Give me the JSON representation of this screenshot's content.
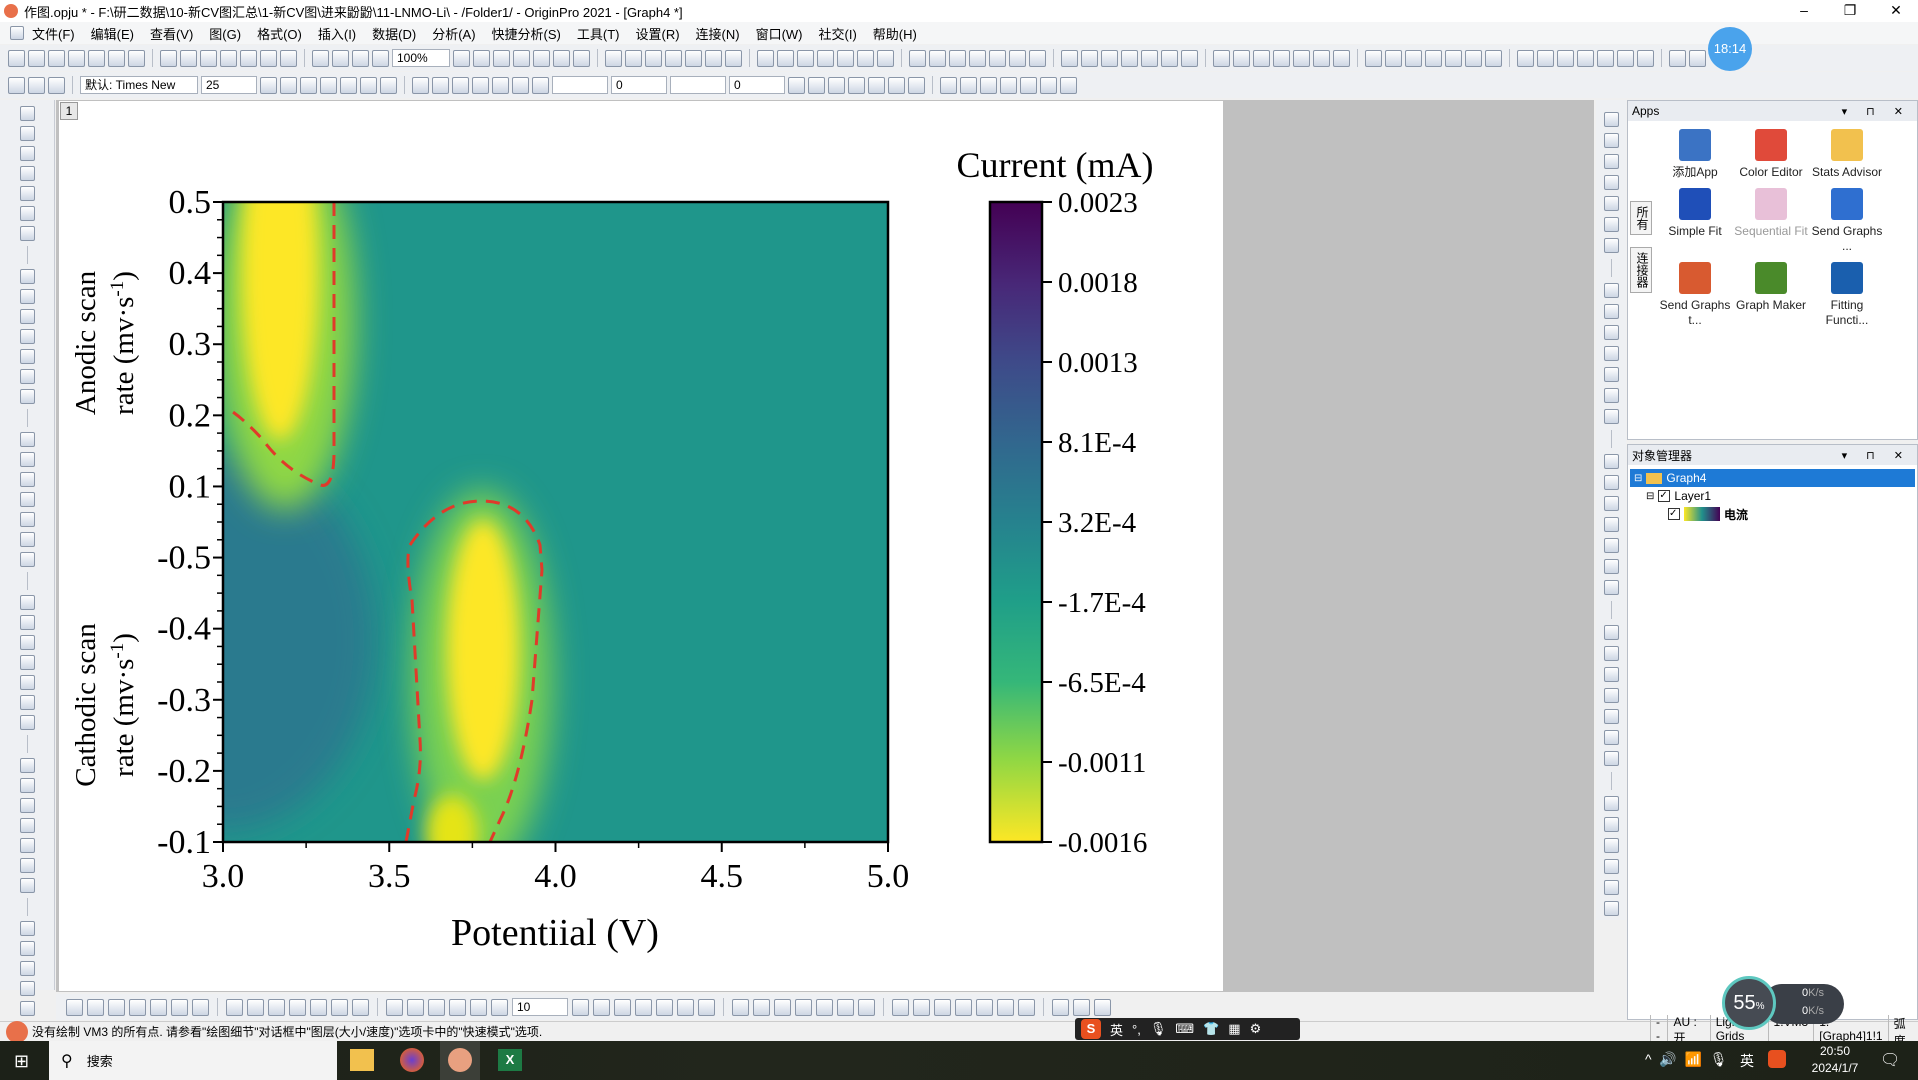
{
  "window": {
    "title": "作图.opju * - F:\\研二数据\\10-新CV图汇总\\1-新CV图\\进来鼢鼢\\11-LNMO-Li\\ - /Folder1/ - OriginPro 2021 - [Graph4 *]",
    "controls": [
      "minimize",
      "restore",
      "close"
    ]
  },
  "menu": [
    "文件(F)",
    "编辑(E)",
    "查看(V)",
    "图(G)",
    "格式(O)",
    "插入(I)",
    "数据(D)",
    "分析(A)",
    "快捷分析(S)",
    "工具(T)",
    "设置(R)",
    "连接(N)",
    "窗口(W)",
    "社交(I)",
    "帮助(H)"
  ],
  "toolbar": {
    "zoom": "100%",
    "font_name": "默认: Times New",
    "font_size": "25",
    "line_width": "0",
    "pattern_value": "0",
    "bottom_size": "10"
  },
  "clock_badge": "18:14",
  "graph": {
    "layer_tab": "1",
    "accent_colors": {
      "contour": "#e03a2a",
      "background": "#21918c"
    }
  },
  "chart_data": {
    "type": "heatmap",
    "colormap": "viridis (reversed: yellow = low, purple = high)",
    "xlabel": "Potentiial (V)",
    "xlim": [
      3.0,
      5.0
    ],
    "xticks": [
      "3.0",
      "3.5",
      "4.0",
      "4.5",
      "5.0"
    ],
    "ylabel_top": "Anodic scan rate (mv·s⁻¹)",
    "ylabel_top_lines": [
      "Anodic scan",
      "rate (mv·s",
      "-1",
      ")"
    ],
    "ylabel_bottom_lines": [
      "Cathodic scan",
      "rate (mv·s",
      "-1",
      ")"
    ],
    "yticks": [
      "0.5",
      "0.4",
      "0.3",
      "0.2",
      "0.1",
      "-0.5",
      "-0.4",
      "-0.3",
      "-0.2",
      "-0.1"
    ],
    "colorbar": {
      "title": "Current (mA)",
      "range": [
        -0.0016,
        0.0023
      ],
      "ticks": [
        "0.0023",
        "0.0018",
        "0.0013",
        "8.1E-4",
        "3.2E-4",
        "-1.7E-4",
        "-6.5E-4",
        "-0.0011",
        "-0.0016"
      ]
    },
    "features": [
      {
        "region": "anodic",
        "potential_range": [
          3.0,
          3.33
        ],
        "rate_range": [
          0.1,
          0.5
        ],
        "value": "low (≈ -0.0016)",
        "contour": "dashed red"
      },
      {
        "region": "cathodic",
        "potential_center": 3.8,
        "potential_range": [
          3.55,
          3.97
        ],
        "rate_range": [
          "-0.5",
          "-0.1"
        ],
        "value": "low (≈ -0.0016)",
        "contour": "dashed red"
      },
      {
        "region": "cathodic left edge",
        "potential_range": [
          3.0,
          3.3
        ],
        "value": "≈ 3.2E-4"
      }
    ],
    "background_value": "≈ -1.7E-4",
    "grid": false
  },
  "apps_panel": {
    "title": "Apps",
    "tabs": [
      "所有",
      "连接器"
    ],
    "items": [
      {
        "label": "添加App",
        "icon": "add-app-icon"
      },
      {
        "label": "Color Editor",
        "icon": "color-editor-icon"
      },
      {
        "label": "Stats Advisor",
        "icon": "magic-wand-icon"
      },
      {
        "label": "Simple Fit",
        "icon": "simple-fit-icon"
      },
      {
        "label": "Sequential Fit",
        "icon": "sequential-fit-icon"
      },
      {
        "label": "Send Graphs ...",
        "icon": "send-word-icon"
      },
      {
        "label": "Send Graphs t...",
        "icon": "send-ppt-icon"
      },
      {
        "label": "Graph Maker",
        "icon": "graph-maker-icon"
      },
      {
        "label": "Fitting Functi...",
        "icon": "fitting-function-icon"
      }
    ]
  },
  "object_manager": {
    "title": "对象管理器",
    "graph": "Graph4",
    "layer": "Layer1",
    "plot": "电流"
  },
  "status": {
    "message": "没有绘制 VM3 的所有点. 请参看\"绘图细节\"对话框中\"图层(大小/速度)\"选项卡中的\"快速模式\"选项.",
    "fields": [
      "--",
      "AU : 开",
      "Light Grids",
      "1:VM3",
      "1:[Graph4]1!1",
      "弧度"
    ]
  },
  "speed_widget": {
    "percent": "55",
    "unit": "%",
    "up": "0",
    "down": "0",
    "rate_unit": "K/s"
  },
  "ime": {
    "lang": "英"
  },
  "taskbar": {
    "search": "搜索",
    "tray_lang": "英",
    "time": "20:50",
    "date": "2024/1/7"
  }
}
